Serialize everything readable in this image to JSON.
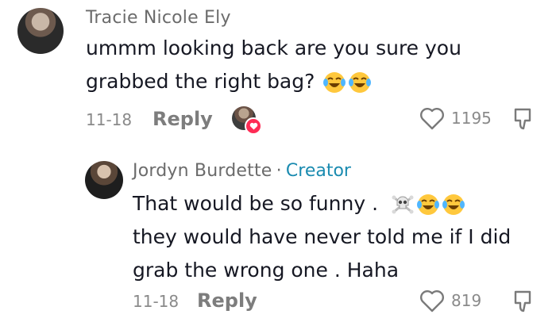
{
  "comment": {
    "author": "Tracie Nicole Ely",
    "text_line1": "ummm looking back are you sure you",
    "text_line2": "grabbed the right bag?",
    "text_emojis": [
      "laughing-tears",
      "laughing-tears"
    ],
    "date": "11-18",
    "reply_label": "Reply",
    "like_count": "1195"
  },
  "reply": {
    "author": "Jordyn Burdette",
    "separator": "·",
    "badge": "Creator",
    "text_line1": "That would be so funny .",
    "text_line1_emojis": [
      "skull-crossbones",
      "laughing-tears",
      "laughing-tears"
    ],
    "text_line2": "they would have never told me if I did",
    "text_line3": "grab the wrong one . Haha",
    "date": "11-18",
    "reply_label": "Reply",
    "like_count": "819"
  },
  "colors": {
    "creator": "#1a8bb0",
    "liked_heart": "#fe2c55",
    "text": "#161823",
    "muted": "#8a8a8a"
  }
}
